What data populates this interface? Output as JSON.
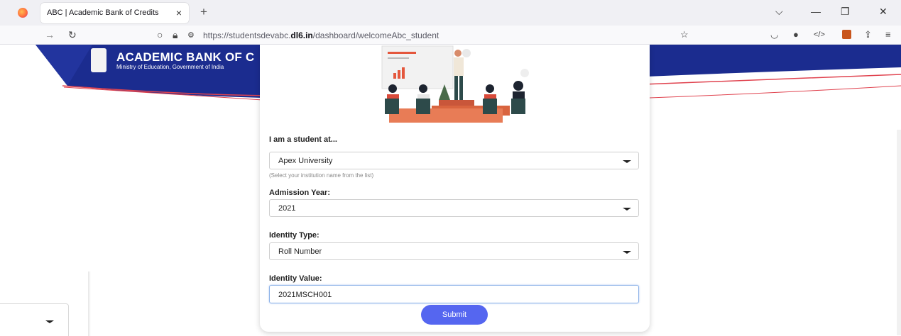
{
  "browser": {
    "tab_title": "ABC | Academic Bank of Credits",
    "tab_close": "×",
    "new_tab": "+",
    "url_prefix": "https://studentsdevabc.",
    "url_domain": "dl6.in",
    "url_path": "/dashboard/welcomeAbc_student"
  },
  "header": {
    "title": "ACADEMIC BANK OF C",
    "subtitle": "Ministry of Education, Government of India"
  },
  "form": {
    "institution_label": "I am a student at...",
    "institution_value": "Apex University",
    "institution_hint": "(Select your institution name from the list)",
    "admission_label": "Admission Year:",
    "admission_value": "2021",
    "identity_type_label": "Identity Type:",
    "identity_type_value": "Roll Number",
    "identity_value_label": "Identity Value:",
    "identity_value": "2021MSCH001",
    "submit_label": "Submit"
  },
  "colors": {
    "banner_blue": "#1b2c8f",
    "accent_red": "#e0434f",
    "submit": "#5566f0"
  }
}
